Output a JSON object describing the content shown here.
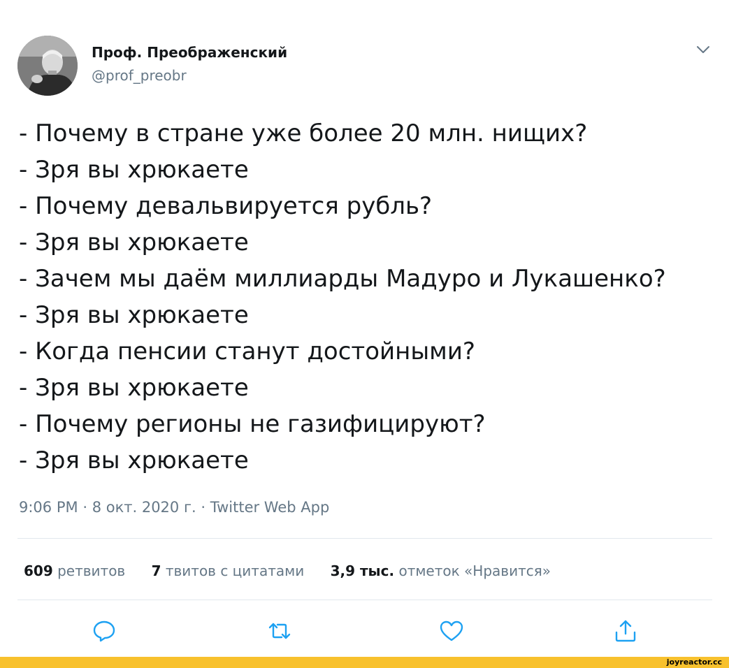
{
  "author": {
    "name": "Проф. Преображенский",
    "handle": "@prof_preobr"
  },
  "tweet": {
    "lines": [
      "- Почему в стране уже более 20 млн. нищих?",
      "- Зря вы хрюкаете",
      "- Почему девальвируется рубль?",
      "- Зря вы хрюкаете",
      "- Зачем мы даём миллиарды Мадуро и Лукашенко?",
      "- Зря вы хрюкаете",
      "- Когда пенсии станут достойными?",
      "- Зря вы хрюкаете",
      "- Почему регионы не газифицируют?",
      "- Зря вы хрюкаете"
    ],
    "time": "9:06 PM",
    "date": "8 окт. 2020 г.",
    "separator": "·",
    "source": "Twitter Web App"
  },
  "stats": {
    "retweets": {
      "count": "609",
      "label": "ретвитов"
    },
    "quotes": {
      "count": "7",
      "label": "твитов с цитатами"
    },
    "likes": {
      "count": "3,9 тыс.",
      "label": "отметок «Нравится»"
    }
  },
  "actions": [
    {
      "icon": "reply-icon"
    },
    {
      "icon": "retweet-icon"
    },
    {
      "icon": "like-icon"
    },
    {
      "icon": "share-icon"
    }
  ],
  "footer": {
    "brand": "joyreactor.cc"
  },
  "colors": {
    "text": "#14171a",
    "secondary": "#657786",
    "icon": "#1da1f2",
    "divider": "#e1e8ed",
    "footer_bar": "#f8c12d"
  }
}
